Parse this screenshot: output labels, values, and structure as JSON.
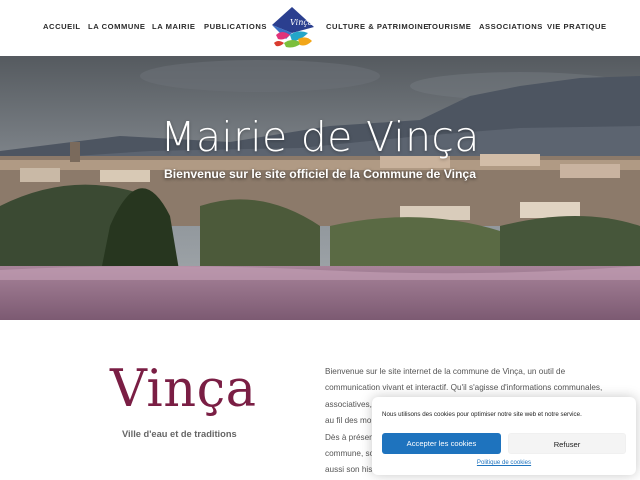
{
  "nav": {
    "items": [
      {
        "label": "ACCUEIL"
      },
      {
        "label": "LA COMMUNE"
      },
      {
        "label": "LA MAIRIE"
      },
      {
        "label": "PUBLICATIONS"
      },
      {
        "label": "CULTURE & PATRIMOINE"
      },
      {
        "label": "TOURISME"
      },
      {
        "label": "ASSOCIATIONS"
      },
      {
        "label": "VIE PRATIQUE"
      }
    ],
    "logo_text": "Vinça"
  },
  "hero": {
    "title": "Mairie de Vinça",
    "subtitle": "Bienvenue sur le site officiel de la Commune de Vinça"
  },
  "brand": {
    "name": "Vinça",
    "tagline": "Ville d'eau et de traditions"
  },
  "intro": {
    "lines": [
      "Bienvenue sur le site internet de la commune de Vinça, un outil de",
      "communication vivant et interactif. Qu'il s'agisse d'informations communales,",
      "associatives,",
      "au fil des mo",
      "Dès à présen",
      "commune, so",
      "aussi son his"
    ]
  },
  "cookie": {
    "message": "Nous utilisons des cookies pour optimiser notre site web et notre service.",
    "accept_label": "Accepter les cookies",
    "refuse_label": "Refuser",
    "policy_label": "Politique de cookies"
  },
  "colors": {
    "brand_wine": "#7a1e44",
    "accept_blue": "#1e73be"
  }
}
